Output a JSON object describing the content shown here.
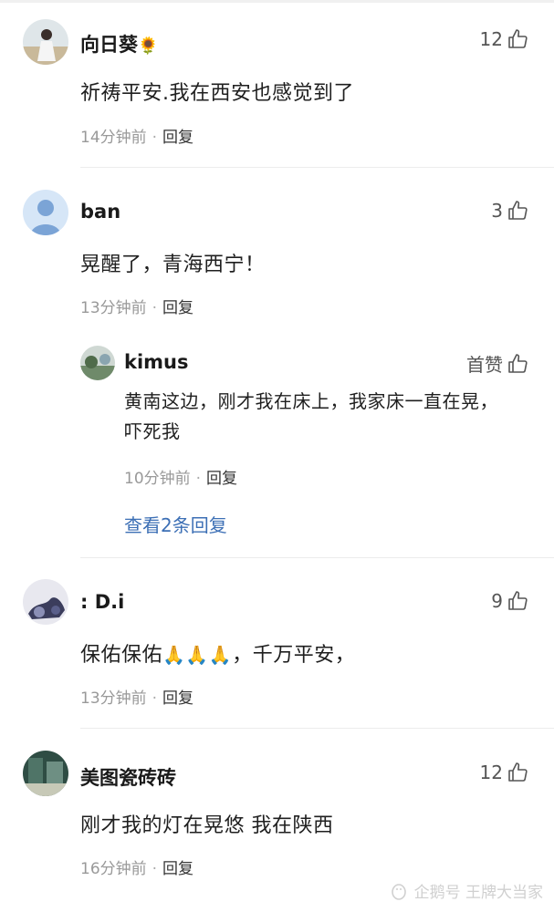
{
  "comments": [
    {
      "user": "向日葵",
      "user_emoji": "🌻",
      "likes": "12",
      "text": "祈祷平安.我在西安也感觉到了",
      "time": "14分钟前",
      "reply_label": "回复"
    },
    {
      "user": "ban",
      "likes": "3",
      "text": "晃醒了，青海西宁！",
      "time": "13分钟前",
      "reply_label": "回复",
      "sub_reply": {
        "user": "kimus",
        "likes": "首赞",
        "text": "黄南这边，刚才我在床上，我家床一直在晃，吓死我",
        "time": "10分钟前",
        "reply_label": "回复"
      },
      "more_replies": "查看2条回复"
    },
    {
      "user": ": D.i",
      "likes": "9",
      "text_before": "保佑保佑",
      "text_emojis": "🙏🙏🙏",
      "text_after": "，千万平安，",
      "time": "13分钟前",
      "reply_label": "回复"
    },
    {
      "user": "美图瓷砖砖",
      "likes": "12",
      "text": "刚才我的灯在晃悠 我在陕西",
      "time": "16分钟前",
      "reply_label": "回复"
    }
  ],
  "meta_separator": "·",
  "watermark": "企鹅号 王牌大当家",
  "colors": {
    "link": "#3c6fb5",
    "meta": "#999999",
    "divider": "#ececec"
  }
}
